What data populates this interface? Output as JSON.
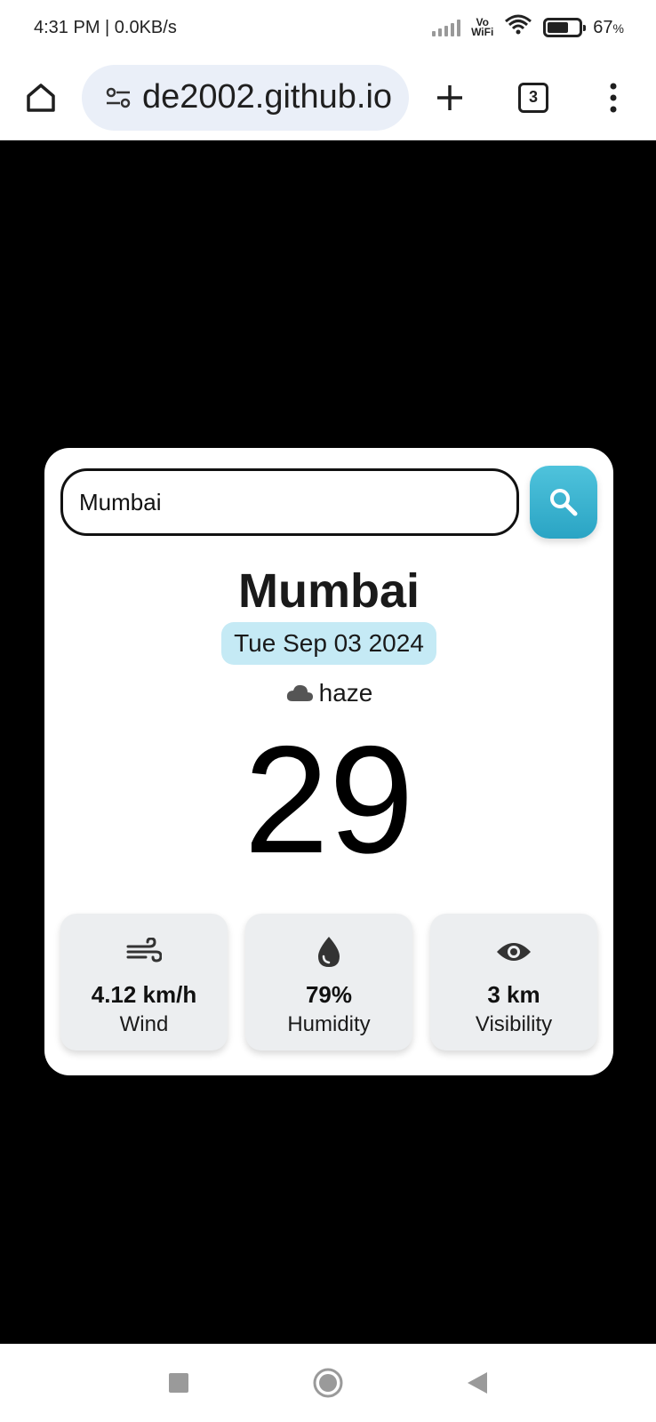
{
  "status_bar": {
    "time": "4:31 PM | 0.0KB/s",
    "vowifi_top": "Vo",
    "vowifi_bottom": "WiFi",
    "battery": "67",
    "battery_level": 0.67,
    "battery_suffix": "%"
  },
  "browser": {
    "url": "de2002.github.io",
    "tab_count": "3",
    "icons": [
      "home-icon",
      "site-settings-icon",
      "new-tab-icon",
      "tab-switcher-icon",
      "more-menu-icon"
    ]
  },
  "weather": {
    "search_value": "Mumbai",
    "city": "Mumbai",
    "date": "Tue Sep 03 2024",
    "condition": "haze",
    "temperature": "29",
    "stats": [
      {
        "icon": "wind-icon",
        "value": "4.12 km/h",
        "label": "Wind"
      },
      {
        "icon": "humidity-drop-icon",
        "value": "79%",
        "label": "Humidity"
      },
      {
        "icon": "eye-icon",
        "value": "3 km",
        "label": "Visibility"
      }
    ],
    "accent": "#2aa4c4",
    "date_bg": "#c5eaf5"
  },
  "nav_bar": {
    "icons": [
      "recents-square-icon",
      "home-circle-icon",
      "back-triangle-icon"
    ]
  }
}
